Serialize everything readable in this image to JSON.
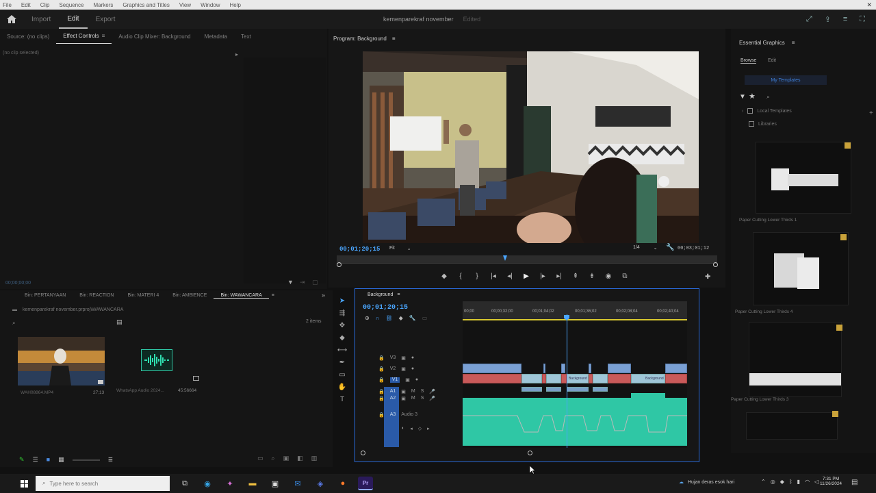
{
  "menu": [
    "File",
    "Edit",
    "Clip",
    "Sequence",
    "Markers",
    "Graphics and Titles",
    "View",
    "Window",
    "Help"
  ],
  "header": {
    "workspaces": [
      "Import",
      "Edit",
      "Export"
    ],
    "active_workspace": "Edit",
    "project_title": "kemenparekraf november",
    "edited_label": "Edited"
  },
  "source_panel": {
    "tabs": [
      "Source: (no clips)",
      "Effect Controls",
      "Audio Clip Mixer: Background",
      "Metadata",
      "Text"
    ],
    "active_tab": "Effect Controls",
    "empty_text": "(no clip selected)",
    "footer_time": "00;00;00;00"
  },
  "program": {
    "title": "Program: Background",
    "timecode": "00;01;20;15",
    "fit_label": "Fit",
    "resolution": "1/4",
    "duration": "00;03;01;12"
  },
  "project_panel": {
    "bins": [
      "Bin: PERTANYAAN",
      "Bin: REACTION",
      "Bin: MATERI 4",
      "Bin: AMBIENCE",
      "Bin: WAWANCARA"
    ],
    "active_bin": "Bin: WAWANCARA",
    "path": "kemenparekraf november.prproj\\WAWANCARA",
    "item_count": "2 items",
    "items": [
      {
        "name": "WAH08864.MP4",
        "duration": "27;13"
      },
      {
        "name": "WhatsApp Audio 2024...",
        "duration": "45:56664"
      }
    ]
  },
  "timeline": {
    "sequence_name": "Background",
    "timecode": "00;01;20;15",
    "ruler_labels": [
      "00;00",
      "00;00;32;00",
      "00;01;04;02",
      "00;01;36;02",
      "00;02;08;04",
      "00;02;40;04"
    ],
    "video_tracks": [
      "V3",
      "V2",
      "V1"
    ],
    "audio_tracks": [
      "A1",
      "A2",
      "A3"
    ],
    "audio_track_name": "Audio 3",
    "clip_labels": [
      "Background",
      "Background"
    ]
  },
  "essential_graphics": {
    "title": "Essential Graphics",
    "tabs": [
      "Browse",
      "Edit"
    ],
    "my_templates": "My Templates",
    "tree": [
      "Local Templates",
      "Libraries"
    ],
    "templates": [
      "Paper Cutting Lower Thirds 1",
      "Paper Cutting Lower Thirds 4",
      "Paper Cutting Lower Thirds 3"
    ]
  },
  "taskbar": {
    "search_placeholder": "Type here to search",
    "weather": "Hujan deras esok hari",
    "time": "7:31 PM",
    "date": "11/26/2024"
  },
  "colors": {
    "accent_blue": "#4aa6ff",
    "audio_green": "#2fc7a5",
    "video_blue": "#7aa0d4",
    "video_red": "#c95a5a",
    "playhead": "#4aa6ff"
  }
}
